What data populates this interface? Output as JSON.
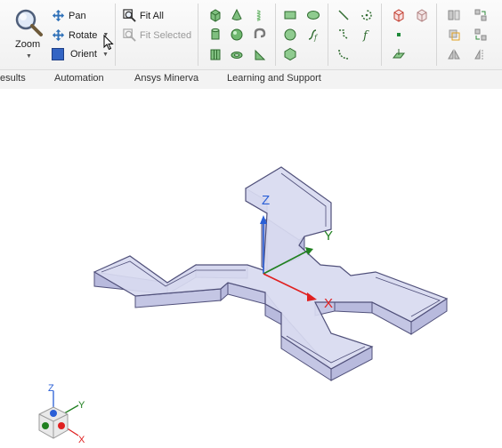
{
  "toolbar": {
    "zoom_label": "Zoom",
    "pan_label": "Pan",
    "rotate_label": "Rotate",
    "orient_label": "Orient",
    "fit_all_label": "Fit All",
    "fit_selected_label": "Fit Selected"
  },
  "ribbon_tabs": [
    {
      "label": "esults"
    },
    {
      "label": "Automation"
    },
    {
      "label": "Ansys Minerva"
    },
    {
      "label": "Learning and Support"
    }
  ],
  "viewport": {
    "axis_labels": {
      "z": "Z",
      "y": "Y",
      "x": "X"
    },
    "triad_labels": {
      "z": "Z",
      "y": "Y",
      "x": "X"
    }
  },
  "colors": {
    "axis_x": "#e02020",
    "axis_y": "#208020",
    "axis_z": "#2a5fd6",
    "part_fill": "#d8daf0",
    "part_edge": "#50507a"
  }
}
